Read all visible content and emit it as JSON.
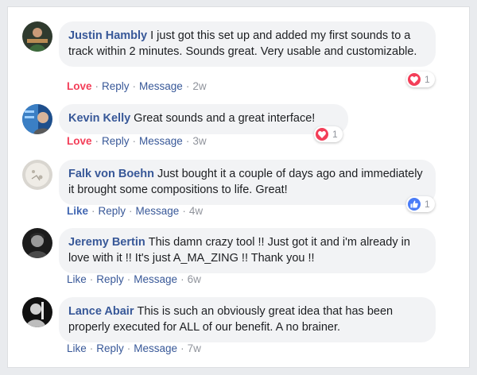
{
  "comments": [
    {
      "author": "Justin Hambly",
      "text": "I just got this set up and added my first sounds to a track within 2 minutes. Sounds great. Very usable and customizable.",
      "action": "Love",
      "reply": "Reply",
      "message": "Message",
      "time": "2w",
      "reaction_icon": "heart-icon",
      "reaction_count": "1"
    },
    {
      "author": "Kevin Kelly",
      "text": "Great sounds and a great interface!",
      "action": "Love",
      "reply": "Reply",
      "message": "Message",
      "time": "3w",
      "reaction_icon": "heart-icon",
      "reaction_count": "1"
    },
    {
      "author": "Falk von Boehn",
      "text": "Just bought it a couple of days ago and immediately it brought some compositions to life. Great!",
      "action": "Like",
      "reply": "Reply",
      "message": "Message",
      "time": "4w",
      "reaction_icon": "thumbs-up-icon",
      "reaction_count": "1"
    },
    {
      "author": "Jeremy Bertin",
      "text": "This damn crazy tool !! Just got it and i'm already in love with it !! It's just A_MA_ZING !! Thank you !!",
      "action": "Like",
      "reply": "Reply",
      "message": "Message",
      "time": "6w"
    },
    {
      "author": "Lance Abair",
      "text": "This is such an obviously great idea that has been properly executed for ALL of our benefit. A no brainer.",
      "action": "Like",
      "reply": "Reply",
      "message": "Message",
      "time": "7w"
    }
  ],
  "colors": {
    "author": "#385898",
    "love": "#f33e58",
    "like": "#4267b2",
    "bubble": "#f2f3f5",
    "meta": "#90949c"
  }
}
